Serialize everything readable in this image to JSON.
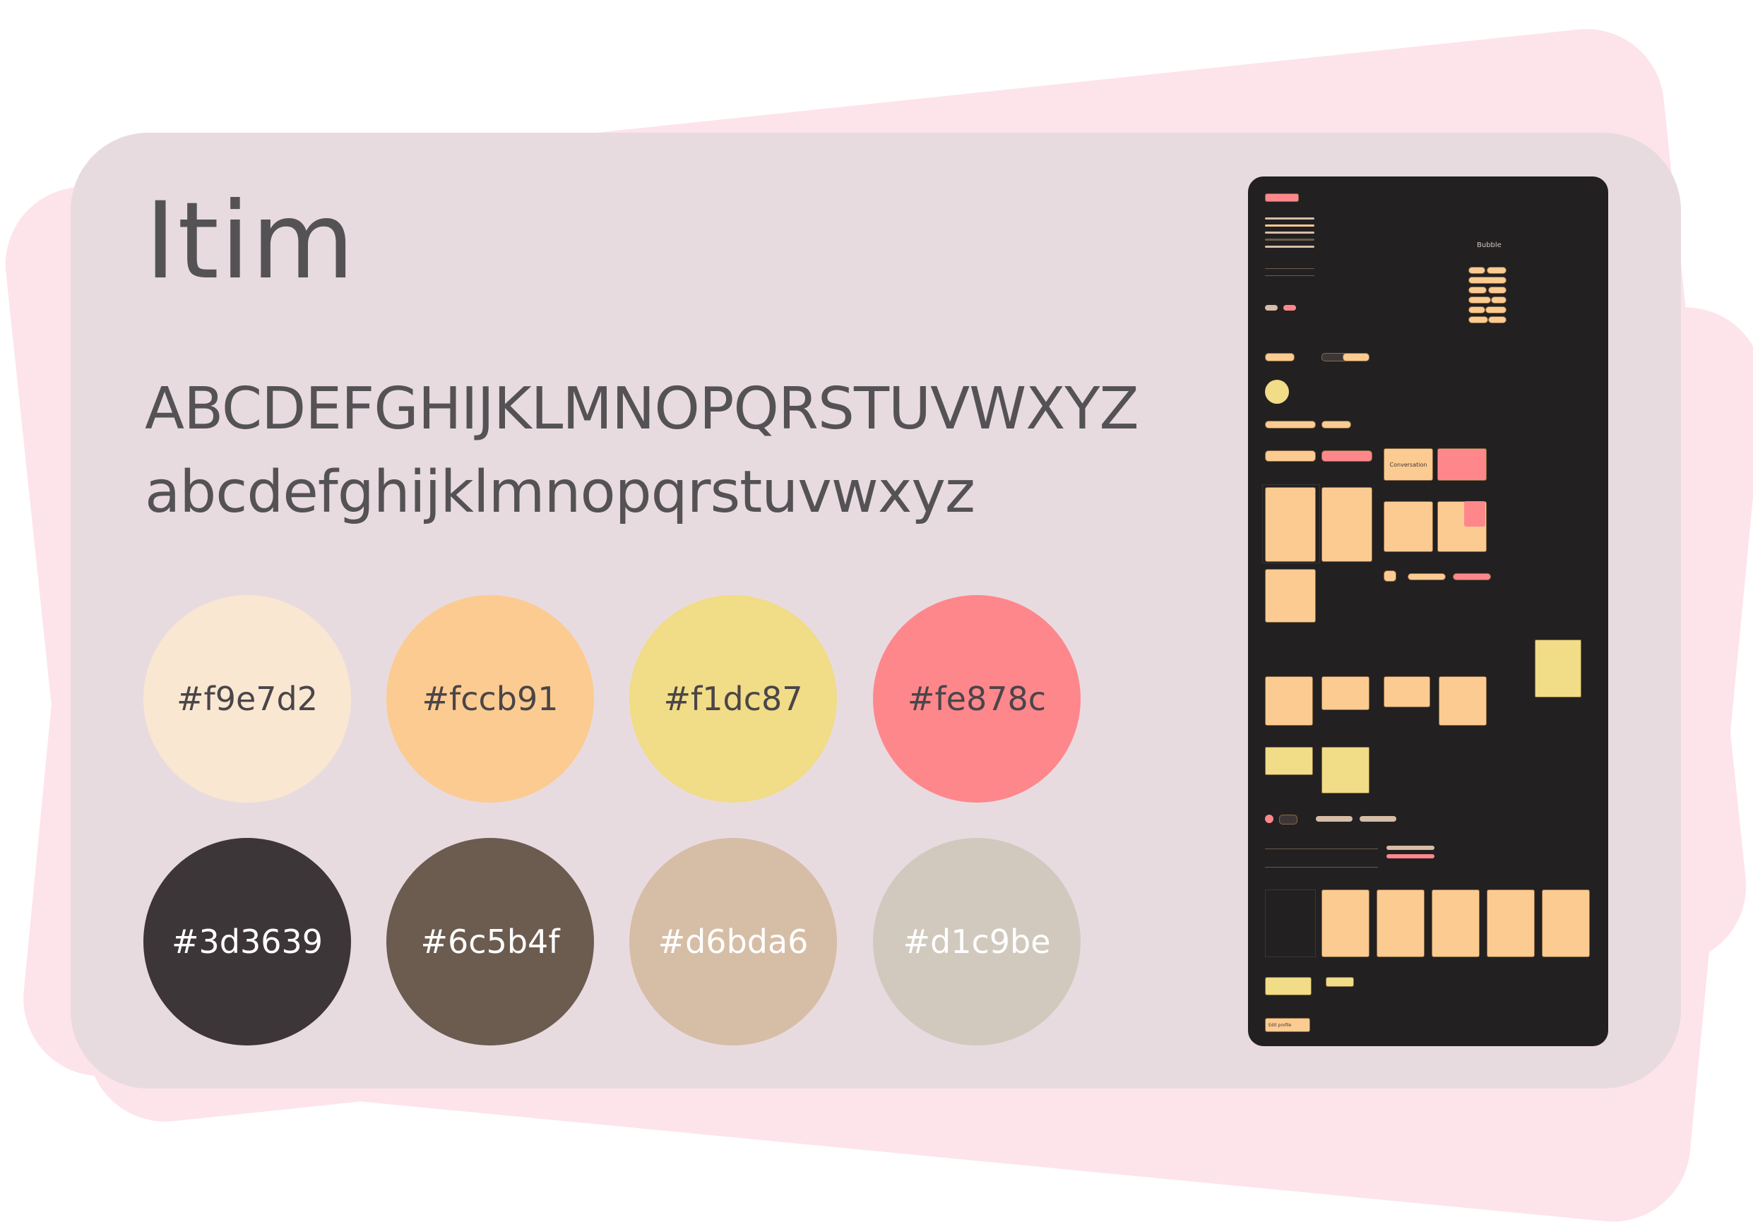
{
  "font": {
    "name": "Itim",
    "uppercase": "ABCDEFGHIJKLMNOPQRSTUVWXYZ",
    "lowercase": "abcdefghijklmnopqrstuvwxyz"
  },
  "palette": [
    {
      "hex": "#f9e7d2",
      "label": "#f9e7d2",
      "text_color": "dark"
    },
    {
      "hex": "#fccb91",
      "label": "#fccb91",
      "text_color": "dark"
    },
    {
      "hex": "#f1dc87",
      "label": "#f1dc87",
      "text_color": "dark"
    },
    {
      "hex": "#fe878c",
      "label": "#fe878c",
      "text_color": "dark"
    },
    {
      "hex": "#3d3639",
      "label": "#3d3639",
      "text_color": "light"
    },
    {
      "hex": "#6c5b4f",
      "label": "#6c5b4f",
      "text_color": "light"
    },
    {
      "hex": "#d6bda6",
      "label": "#d6bda6",
      "text_color": "light"
    },
    {
      "hex": "#d1c9be",
      "label": "#d1c9be",
      "text_color": "light"
    }
  ],
  "preview": {
    "heading": "Bubble",
    "edit_button": "Edit profile",
    "conversation_label": "Conversation"
  },
  "colors": {
    "background_card": "#fde4ea",
    "main_card": "#e8dbe0",
    "text": "#555255",
    "preview_bg": "#222021"
  }
}
